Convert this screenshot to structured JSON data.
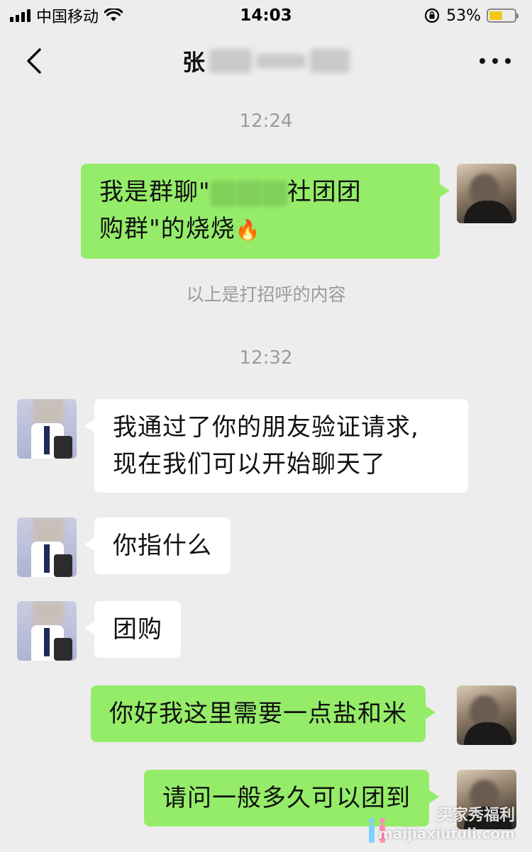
{
  "status_bar": {
    "carrier": "中国移动",
    "time": "14:03",
    "battery_percent": "53%",
    "battery_level": 0.53,
    "icons": [
      "signal-icon",
      "wifi-icon",
      "rotation-lock-icon",
      "battery-icon"
    ]
  },
  "nav": {
    "title_visible": "张",
    "back_icon": "chevron-left-icon",
    "more_icon": "more-dots-icon"
  },
  "chat": {
    "time_1": "12:24",
    "msg_1_part1": "我是群聊\"",
    "msg_1_part2": "社团团",
    "msg_1_part3": "购群\"的烧烧",
    "msg_1_emoji": "🔥",
    "system_note": "以上是打招呼的内容",
    "time_2": "12:32",
    "msg_2_line1": "我通过了你的朋友验证请求,",
    "msg_2_line2": "现在我们可以开始聊天了",
    "msg_3": "你指什么",
    "msg_4": "团购",
    "msg_5": "你好我这里需要一点盐和米",
    "msg_6": "请问一般多久可以团到"
  },
  "watermark": {
    "title": "买家秀福利",
    "url": "maijiaxiufuli.com"
  },
  "colors": {
    "background": "#ededed",
    "my_bubble": "#95ec69",
    "other_bubble": "#ffffff",
    "meta_text": "#9b9b9b"
  }
}
